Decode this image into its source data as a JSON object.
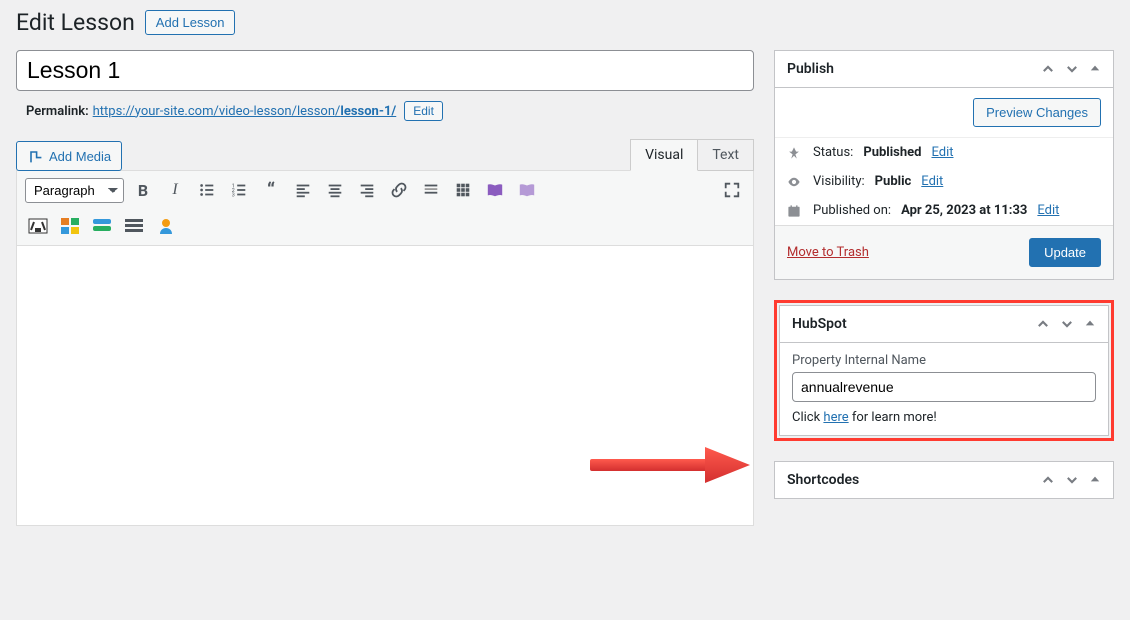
{
  "header": {
    "title": "Edit Lesson",
    "add_button": "Add Lesson"
  },
  "post": {
    "title": "Lesson 1",
    "permalink_label": "Permalink:",
    "permalink_base": "https://your-site.com/video-lesson/lesson/",
    "permalink_slug": "lesson-1/",
    "edit_label": "Edit"
  },
  "editor": {
    "add_media": "Add Media",
    "tab_visual": "Visual",
    "tab_text": "Text",
    "format_label": "Paragraph"
  },
  "publish": {
    "title": "Publish",
    "preview_btn": "Preview Changes",
    "status_label": "Status:",
    "status_value": "Published",
    "status_edit": "Edit",
    "visibility_label": "Visibility:",
    "visibility_value": "Public",
    "visibility_edit": "Edit",
    "published_label": "Published on:",
    "published_value": "Apr 25, 2023 at 11:33",
    "published_edit": "Edit",
    "trash": "Move to Trash",
    "update": "Update"
  },
  "hubspot": {
    "title": "HubSpot",
    "field_label": "Property Internal Name",
    "field_value": "annualrevenue",
    "help_pre": "Click ",
    "help_link": "here",
    "help_post": " for learn more!"
  },
  "shortcodes": {
    "title": "Shortcodes"
  }
}
